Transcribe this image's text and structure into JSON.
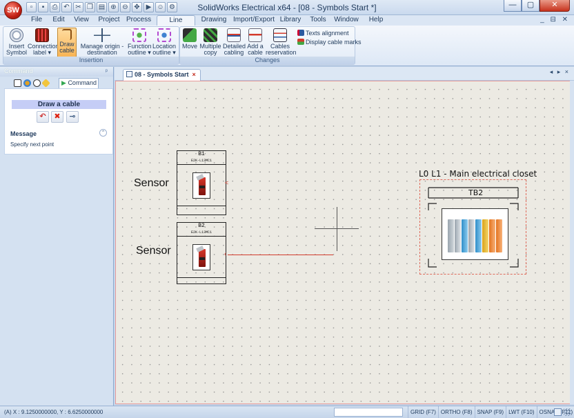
{
  "window": {
    "title": "SolidWorks Electrical x64 - [08 - Symbols Start *]",
    "logo_text": "SW",
    "buttons": {
      "minimize": "—",
      "maximize": "▢",
      "close": "✕"
    }
  },
  "ribbon_tabs": [
    "File",
    "Edit",
    "View",
    "Project",
    "Process",
    "Line diagram",
    "Drawing",
    "Import/Export",
    "Library",
    "Tools",
    "Window",
    "Help"
  ],
  "active_tab": "Line diagram",
  "mdi_controls": "_ ⊟ ✕",
  "ribbon": {
    "groups": [
      {
        "title": "Insertion",
        "buttons": [
          {
            "line1": "Insert",
            "line2": "Symbol"
          },
          {
            "line1": "Connection",
            "line2": "label ▾"
          },
          {
            "line1": "Draw",
            "line2": "cable"
          },
          {
            "line1": "Manage origin -",
            "line2": "destination arrows"
          },
          {
            "line1": "Function",
            "line2": "outline ▾"
          },
          {
            "line1": "Location",
            "line2": "outline ▾"
          }
        ]
      },
      {
        "title": "Changes",
        "buttons": [
          {
            "line1": "Move",
            "line2": ""
          },
          {
            "line1": "Multiple",
            "line2": "copy"
          },
          {
            "line1": "Detailed",
            "line2": "cabling"
          },
          {
            "line1": "Add a",
            "line2": "cable"
          },
          {
            "line1": "Cables",
            "line2": "reservation"
          }
        ],
        "small_buttons": [
          "Texts alignment",
          "Display cable marks"
        ]
      }
    ]
  },
  "left_panel": {
    "header": "Command",
    "pin": "ᵖ",
    "active_tab": "Command",
    "command_title": "Draw a cable",
    "command_buttons": [
      "↶",
      "✖",
      "⊸"
    ],
    "message_title": "Message",
    "message_collapse": "⌃",
    "message_text": "Specify next point"
  },
  "document": {
    "tab_title": "08 - Symbols Start",
    "close": "×",
    "nav": "◂ ▸ ×"
  },
  "canvas": {
    "symbols": [
      {
        "label": "Sensor",
        "tag": "B1",
        "ref": "E2K-L13MC1"
      },
      {
        "label": "Sensor",
        "tag": "B2",
        "ref": "E2K-L13MC1"
      }
    ],
    "location_label": "L0 L1 - Main electrical closet",
    "terminal_block": "TB2"
  },
  "status_bar": {
    "coords": "(A) X : 9.1250000000, Y : 6.6250000000",
    "toggles": [
      "GRID (F7)",
      "ORTHO (F8)",
      "SNAP (F9)",
      "LWT (F10)",
      "OSNAP (F11)"
    ]
  },
  "colors": {
    "accent": "#f8b454",
    "canvas_bg": "#eceae3",
    "cable": "#d33b2c",
    "ribbon_bg": "#dde8f6"
  }
}
